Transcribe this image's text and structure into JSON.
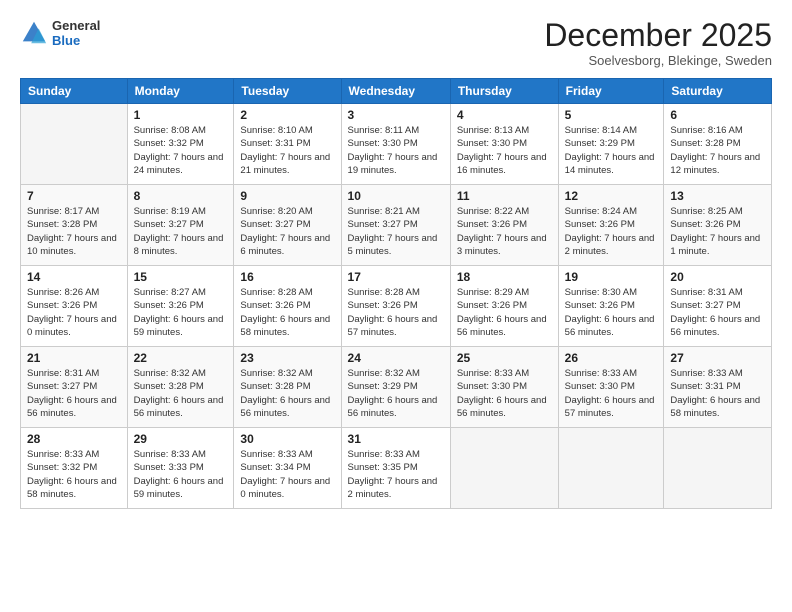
{
  "header": {
    "logo_general": "General",
    "logo_blue": "Blue",
    "month_title": "December 2025",
    "subtitle": "Soelvesborg, Blekinge, Sweden"
  },
  "days_of_week": [
    "Sunday",
    "Monday",
    "Tuesday",
    "Wednesday",
    "Thursday",
    "Friday",
    "Saturday"
  ],
  "weeks": [
    [
      {
        "day": "",
        "info": ""
      },
      {
        "day": "1",
        "info": "Sunrise: 8:08 AM\nSunset: 3:32 PM\nDaylight: 7 hours and 24 minutes."
      },
      {
        "day": "2",
        "info": "Sunrise: 8:10 AM\nSunset: 3:31 PM\nDaylight: 7 hours and 21 minutes."
      },
      {
        "day": "3",
        "info": "Sunrise: 8:11 AM\nSunset: 3:30 PM\nDaylight: 7 hours and 19 minutes."
      },
      {
        "day": "4",
        "info": "Sunrise: 8:13 AM\nSunset: 3:30 PM\nDaylight: 7 hours and 16 minutes."
      },
      {
        "day": "5",
        "info": "Sunrise: 8:14 AM\nSunset: 3:29 PM\nDaylight: 7 hours and 14 minutes."
      },
      {
        "day": "6",
        "info": "Sunrise: 8:16 AM\nSunset: 3:28 PM\nDaylight: 7 hours and 12 minutes."
      }
    ],
    [
      {
        "day": "7",
        "info": "Sunrise: 8:17 AM\nSunset: 3:28 PM\nDaylight: 7 hours and 10 minutes."
      },
      {
        "day": "8",
        "info": "Sunrise: 8:19 AM\nSunset: 3:27 PM\nDaylight: 7 hours and 8 minutes."
      },
      {
        "day": "9",
        "info": "Sunrise: 8:20 AM\nSunset: 3:27 PM\nDaylight: 7 hours and 6 minutes."
      },
      {
        "day": "10",
        "info": "Sunrise: 8:21 AM\nSunset: 3:27 PM\nDaylight: 7 hours and 5 minutes."
      },
      {
        "day": "11",
        "info": "Sunrise: 8:22 AM\nSunset: 3:26 PM\nDaylight: 7 hours and 3 minutes."
      },
      {
        "day": "12",
        "info": "Sunrise: 8:24 AM\nSunset: 3:26 PM\nDaylight: 7 hours and 2 minutes."
      },
      {
        "day": "13",
        "info": "Sunrise: 8:25 AM\nSunset: 3:26 PM\nDaylight: 7 hours and 1 minute."
      }
    ],
    [
      {
        "day": "14",
        "info": "Sunrise: 8:26 AM\nSunset: 3:26 PM\nDaylight: 7 hours and 0 minutes."
      },
      {
        "day": "15",
        "info": "Sunrise: 8:27 AM\nSunset: 3:26 PM\nDaylight: 6 hours and 59 minutes."
      },
      {
        "day": "16",
        "info": "Sunrise: 8:28 AM\nSunset: 3:26 PM\nDaylight: 6 hours and 58 minutes."
      },
      {
        "day": "17",
        "info": "Sunrise: 8:28 AM\nSunset: 3:26 PM\nDaylight: 6 hours and 57 minutes."
      },
      {
        "day": "18",
        "info": "Sunrise: 8:29 AM\nSunset: 3:26 PM\nDaylight: 6 hours and 56 minutes."
      },
      {
        "day": "19",
        "info": "Sunrise: 8:30 AM\nSunset: 3:26 PM\nDaylight: 6 hours and 56 minutes."
      },
      {
        "day": "20",
        "info": "Sunrise: 8:31 AM\nSunset: 3:27 PM\nDaylight: 6 hours and 56 minutes."
      }
    ],
    [
      {
        "day": "21",
        "info": "Sunrise: 8:31 AM\nSunset: 3:27 PM\nDaylight: 6 hours and 56 minutes."
      },
      {
        "day": "22",
        "info": "Sunrise: 8:32 AM\nSunset: 3:28 PM\nDaylight: 6 hours and 56 minutes."
      },
      {
        "day": "23",
        "info": "Sunrise: 8:32 AM\nSunset: 3:28 PM\nDaylight: 6 hours and 56 minutes."
      },
      {
        "day": "24",
        "info": "Sunrise: 8:32 AM\nSunset: 3:29 PM\nDaylight: 6 hours and 56 minutes."
      },
      {
        "day": "25",
        "info": "Sunrise: 8:33 AM\nSunset: 3:30 PM\nDaylight: 6 hours and 56 minutes."
      },
      {
        "day": "26",
        "info": "Sunrise: 8:33 AM\nSunset: 3:30 PM\nDaylight: 6 hours and 57 minutes."
      },
      {
        "day": "27",
        "info": "Sunrise: 8:33 AM\nSunset: 3:31 PM\nDaylight: 6 hours and 58 minutes."
      }
    ],
    [
      {
        "day": "28",
        "info": "Sunrise: 8:33 AM\nSunset: 3:32 PM\nDaylight: 6 hours and 58 minutes."
      },
      {
        "day": "29",
        "info": "Sunrise: 8:33 AM\nSunset: 3:33 PM\nDaylight: 6 hours and 59 minutes."
      },
      {
        "day": "30",
        "info": "Sunrise: 8:33 AM\nSunset: 3:34 PM\nDaylight: 7 hours and 0 minutes."
      },
      {
        "day": "31",
        "info": "Sunrise: 8:33 AM\nSunset: 3:35 PM\nDaylight: 7 hours and 2 minutes."
      },
      {
        "day": "",
        "info": ""
      },
      {
        "day": "",
        "info": ""
      },
      {
        "day": "",
        "info": ""
      }
    ]
  ]
}
